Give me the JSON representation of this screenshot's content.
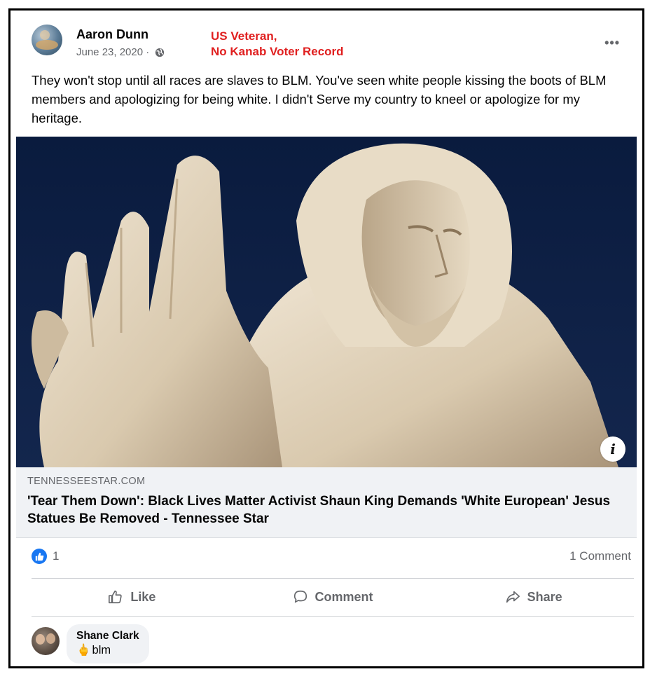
{
  "post": {
    "author": "Aaron Dunn",
    "date": "June 23, 2020 ·",
    "privacy_icon": "globe-icon",
    "annotation_line1": "US Veteran,",
    "annotation_line2": "No Kanab Voter Record",
    "annotation_color": "#e02020",
    "more_label": "•••",
    "text": "They won't stop until all races are slaves to BLM. You've seen white people kissing the boots of BLM members and apologizing for being white. I didn't Serve my country to kneel or apologize for my heritage."
  },
  "link": {
    "domain": "TENNESSEESTAR.COM",
    "headline": "'Tear Them Down': Black Lives Matter Activist Shaun King Demands 'White European' Jesus Statues Be Removed - Tennessee Star",
    "info_label": "i"
  },
  "stats": {
    "like_count": "1",
    "comment_count": "1 Comment"
  },
  "actions": {
    "like": "Like",
    "comment": "Comment",
    "share": "Share"
  },
  "comment": {
    "author": "Shane Clark",
    "text": "blm",
    "emoji": "🖕"
  },
  "colors": {
    "brand_blue": "#1877f2",
    "secondary_text": "#65676b",
    "link_bg": "#f0f2f5"
  }
}
